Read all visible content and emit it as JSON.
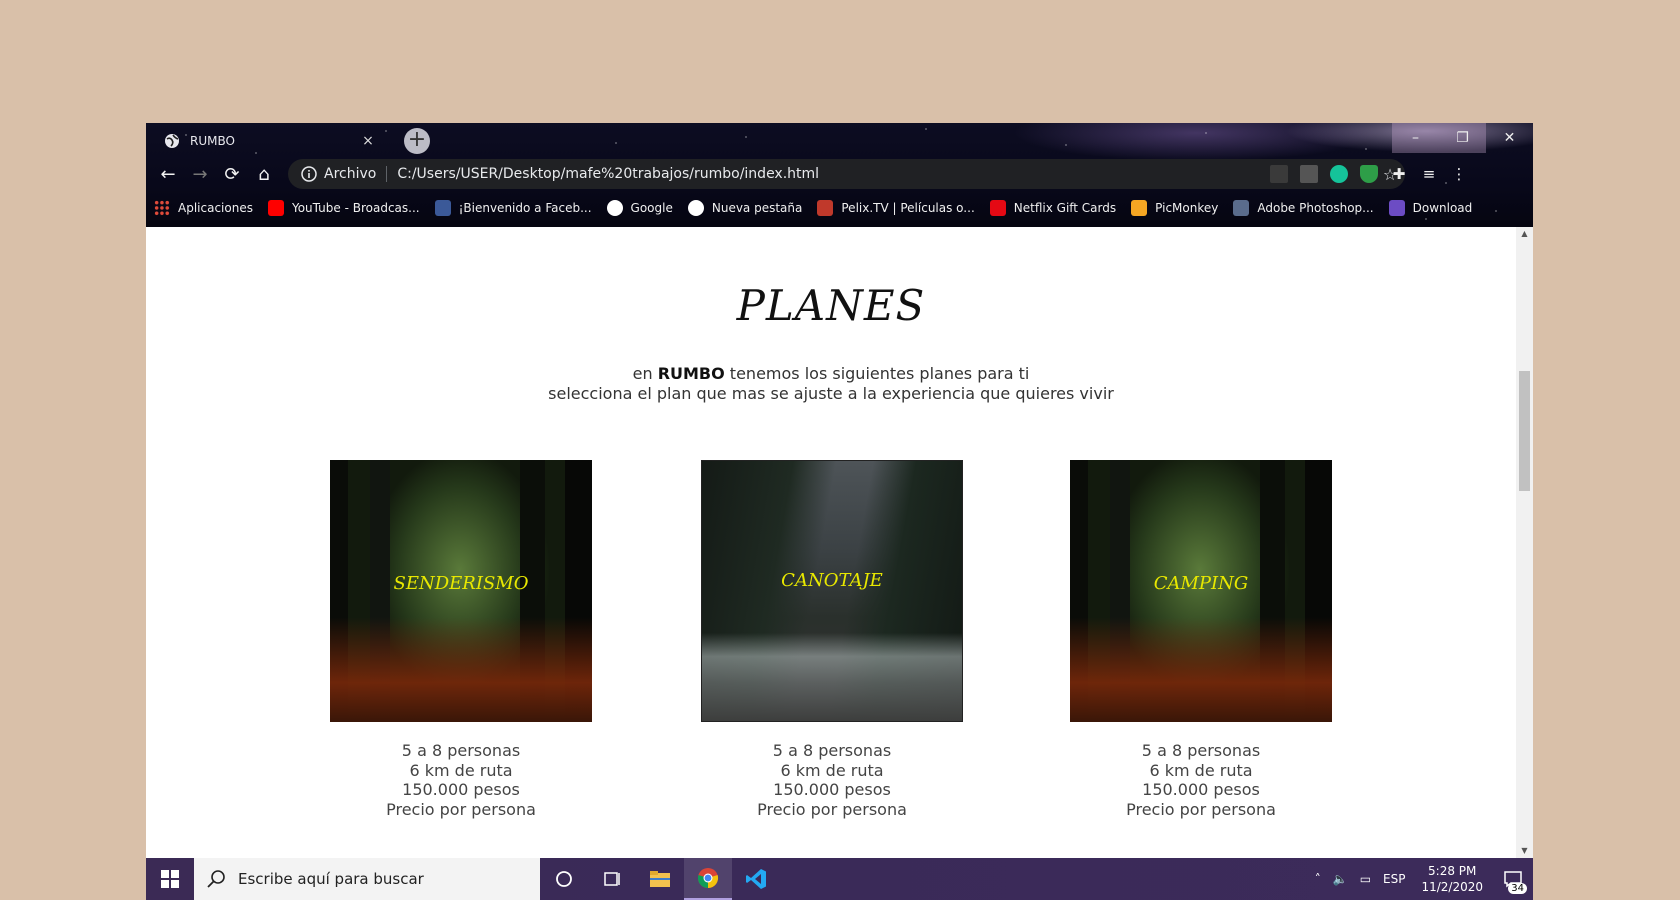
{
  "browser": {
    "tab_title": "RUMBO",
    "tab_close": "×",
    "new_tab": "+",
    "window_controls": {
      "minimize": "–",
      "maximize": "❐",
      "close": "✕"
    },
    "nav": {
      "back": "←",
      "forward": "→",
      "reload": "⟳",
      "home": "⌂"
    },
    "omnibox_chip": "Archivo",
    "url": "C:/Users/USER/Desktop/mafe%20trabajos/rumbo/index.html",
    "bookmarks": [
      {
        "label": "Aplicaciones",
        "icon": "apps-grid-icon",
        "color": "#e04b3a"
      },
      {
        "label": "YouTube - Broadcas...",
        "icon": "youtube-icon",
        "color": "#ff0000"
      },
      {
        "label": "¡Bienvenido a Faceb...",
        "icon": "facebook-icon",
        "color": "#3b5998"
      },
      {
        "label": "Google",
        "icon": "google-icon",
        "color": "#ffffff"
      },
      {
        "label": "Nueva pestaña",
        "icon": "globe-icon",
        "color": "#ffffff"
      },
      {
        "label": "Pelix.TV | Películas o...",
        "icon": "pelix-icon",
        "color": "#c0392b"
      },
      {
        "label": "Netflix Gift Cards",
        "icon": "netflix-icon",
        "color": "#e50914"
      },
      {
        "label": "PicMonkey",
        "icon": "picmonkey-icon",
        "color": "#f5a623"
      },
      {
        "label": "Adobe Photoshop...",
        "icon": "photoshop-icon",
        "color": "#5a6c8c"
      },
      {
        "label": "Download",
        "icon": "download-b-icon",
        "color": "#6c4cc4"
      }
    ]
  },
  "page": {
    "title": "PLANES",
    "intro_pre": "en ",
    "intro_brand": "RUMBO",
    "intro_post": " tenemos los siguientes planes para ti",
    "intro_line2": "selecciona el plan que mas se ajuste a la experiencia que quieres vivir",
    "plans": [
      {
        "name": "SENDERISMO",
        "line1": "5 a 8 personas",
        "line2": "6 km de ruta",
        "line3": "150.000 pesos",
        "line4": "Precio por persona"
      },
      {
        "name": "CANOTAJE",
        "line1": "5 a 8 personas",
        "line2": "6 km de ruta",
        "line3": "150.000 pesos",
        "line4": "Precio por persona"
      },
      {
        "name": "CAMPING",
        "line1": "5 a 8 personas",
        "line2": "6 km de ruta",
        "line3": "150.000 pesos",
        "line4": "Precio por persona"
      }
    ]
  },
  "scrollbar": {
    "position_fraction": 0.27
  },
  "taskbar": {
    "search_placeholder": "Escribe aquí para buscar",
    "tray_language": "ESP",
    "time": "5:28 PM",
    "date": "11/2/2020",
    "notification_count": "34"
  },
  "colors": {
    "desktop_bg": "#d9c0a9",
    "plan_label": "#e8e800",
    "taskbar": "#3b2a55"
  }
}
